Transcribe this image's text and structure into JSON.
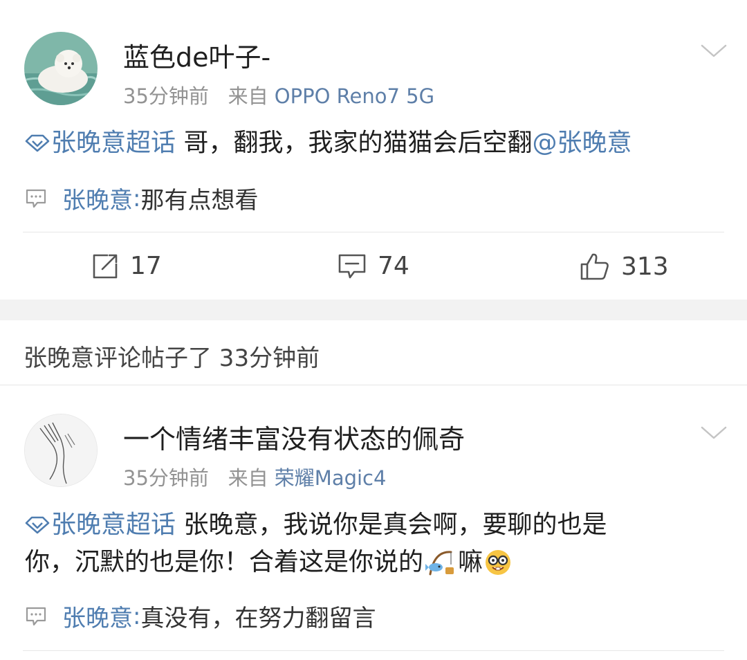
{
  "post1": {
    "username": "蓝色de叶子-",
    "time": "35分钟前",
    "from_label": "来自",
    "device": "OPPO Reno7 5G",
    "topic": "张晚意超话",
    "text": " 哥，翻我，我家的猫猫会后空翻",
    "mention": "@张晚意",
    "reply_name": "张晚意",
    "reply_sep": ":",
    "reply_text": " 那有点想看",
    "repost_count": "17",
    "comment_count": "74",
    "like_count": "313"
  },
  "notice": {
    "text": "张晚意评论帖子了 33分钟前"
  },
  "post2": {
    "username": "一个情绪丰富没有状态的佩奇",
    "time": "35分钟前",
    "from_label": "来自",
    "device": "荣耀Magic4",
    "topic": "张晚意超话",
    "text_line1": "  张晚意，我说你是真会啊，要聊的也是",
    "text_line2": "你，沉默的也是你！合着这是你说的",
    "text_tail": "嘛",
    "reply_name": "张晚意",
    "reply_sep": ":",
    "reply_text": " 真没有，在努力翻留言"
  },
  "colors": {
    "link": "#4f7db0",
    "meta": "#939393",
    "gap": "#f2f2f2"
  }
}
